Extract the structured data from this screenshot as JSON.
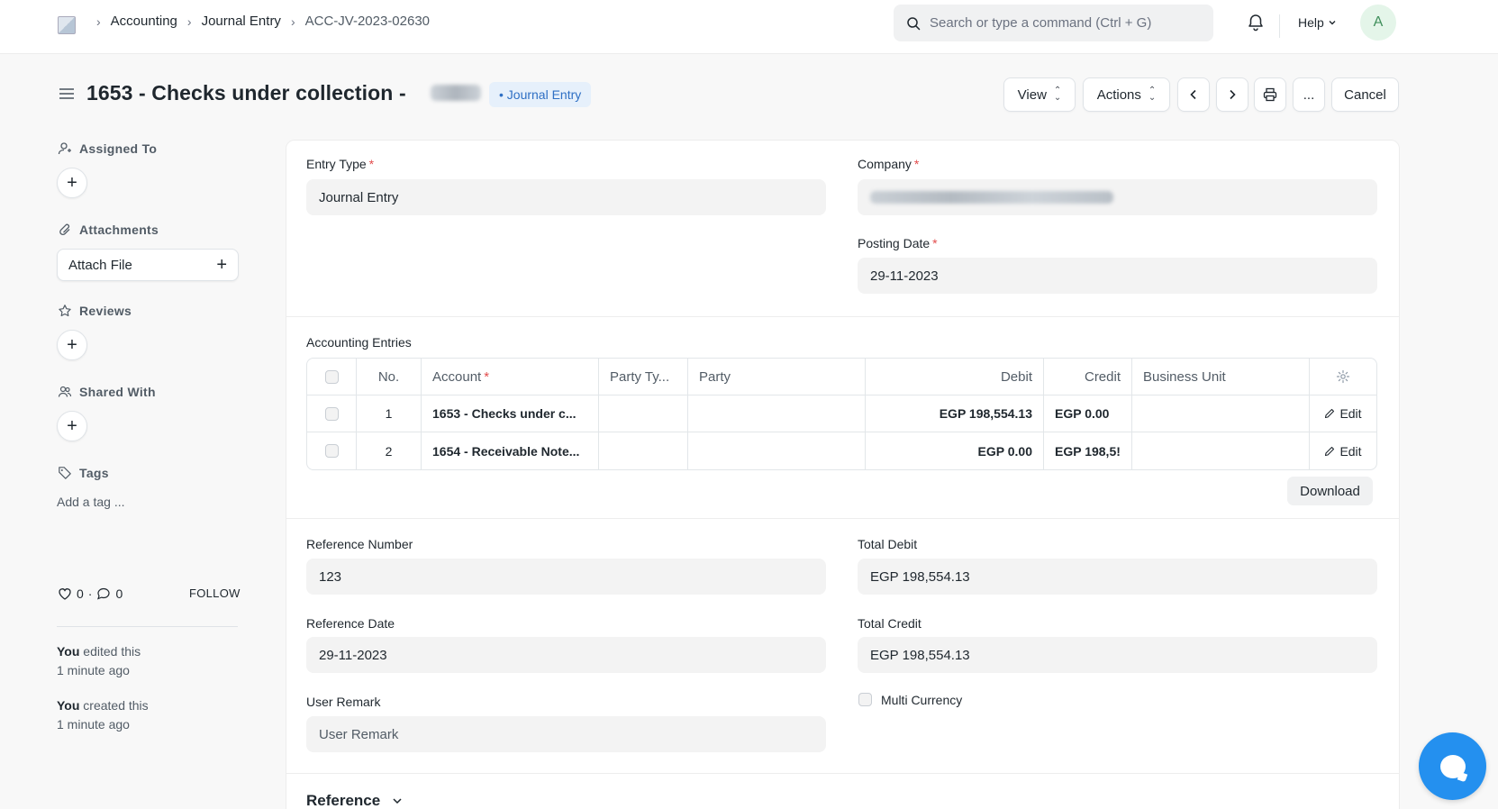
{
  "navbar": {
    "breadcrumbs": [
      "Accounting",
      "Journal Entry",
      "ACC-JV-2023-02630"
    ],
    "search_placeholder": "Search or type a command (Ctrl + G)",
    "help_label": "Help",
    "avatar_initial": "A"
  },
  "header": {
    "title": "1653 - Checks under collection -",
    "status": "• Journal Entry",
    "view_label": "View",
    "actions_label": "Actions",
    "more_label": "...",
    "cancel_label": "Cancel"
  },
  "sidebar": {
    "assigned_to": "Assigned To",
    "attachments": "Attachments",
    "attach_file": "Attach File",
    "reviews": "Reviews",
    "shared_with": "Shared With",
    "tags": "Tags",
    "add_tag": "Add a tag ...",
    "likes_count": "0",
    "comments_count": "0",
    "follow_label": "FOLLOW",
    "activity": [
      {
        "who": "You",
        "action": " edited this",
        "when": "1 minute ago"
      },
      {
        "who": "You",
        "action": " created this",
        "when": "1 minute ago"
      }
    ]
  },
  "form": {
    "entry_type_label": "Entry Type",
    "entry_type_value": "Journal Entry",
    "company_label": "Company",
    "posting_date_label": "Posting Date",
    "posting_date_value": "29-11-2023",
    "accounting_entries_label": "Accounting Entries",
    "reference_number_label": "Reference Number",
    "reference_number_value": "123",
    "reference_date_label": "Reference Date",
    "reference_date_value": "29-11-2023",
    "user_remark_label": "User Remark",
    "user_remark_placeholder": "User Remark",
    "total_debit_label": "Total Debit",
    "total_debit_value": "EGP 198,554.13",
    "total_credit_label": "Total Credit",
    "total_credit_value": "EGP 198,554.13",
    "multi_currency_label": "Multi Currency",
    "reference_section": "Reference",
    "download_label": "Download"
  },
  "table": {
    "headers": {
      "no": "No.",
      "account": "Account",
      "party_type": "Party Ty...",
      "party": "Party",
      "debit": "Debit",
      "credit": "Credit",
      "business_unit": "Business Unit"
    },
    "edit_label": "Edit",
    "rows": [
      {
        "no": "1",
        "account": "1653 - Checks under c...",
        "party_type": "",
        "party": "",
        "debit": "EGP 198,554.13",
        "credit": "EGP 0.00",
        "business_unit": ""
      },
      {
        "no": "2",
        "account": "1654 - Receivable Note...",
        "party_type": "",
        "party": "",
        "debit": "EGP 0.00",
        "credit": "EGP 198,5!",
        "business_unit": ""
      }
    ]
  },
  "colors": {
    "accent": "#2490ef",
    "status_bg": "#e6f0fb",
    "status_text": "#2e6fc4",
    "required": "#e24c4c"
  }
}
